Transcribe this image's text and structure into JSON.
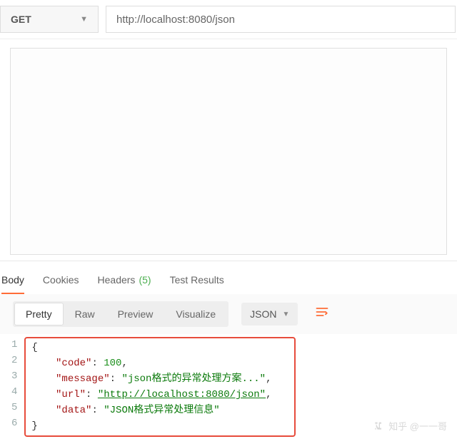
{
  "request": {
    "method": "GET",
    "url": "http://localhost:8080/json"
  },
  "tabs": {
    "body": "Body",
    "cookies": "Cookies",
    "headers": "Headers",
    "headers_count": "(5)",
    "test_results": "Test Results"
  },
  "view": {
    "pretty": "Pretty",
    "raw": "Raw",
    "preview": "Preview",
    "visualize": "Visualize",
    "format": "JSON"
  },
  "gutter": {
    "l1": "1",
    "l2": "2",
    "l3": "3",
    "l4": "4",
    "l5": "5",
    "l6": "6"
  },
  "json": {
    "open": "{",
    "close": "}",
    "k_code": "\"code\"",
    "v_code": "100",
    "k_message": "\"message\"",
    "v_message": "\"json格式的异常处理方案...\"",
    "k_url": "\"url\"",
    "v_url": "\"http://localhost:8080/json\"",
    "k_data": "\"data\"",
    "v_data": "\"JSON格式异常处理信息\""
  },
  "punct": {
    "colon": ": ",
    "comma": ","
  },
  "watermark": "知乎 @一一哥"
}
